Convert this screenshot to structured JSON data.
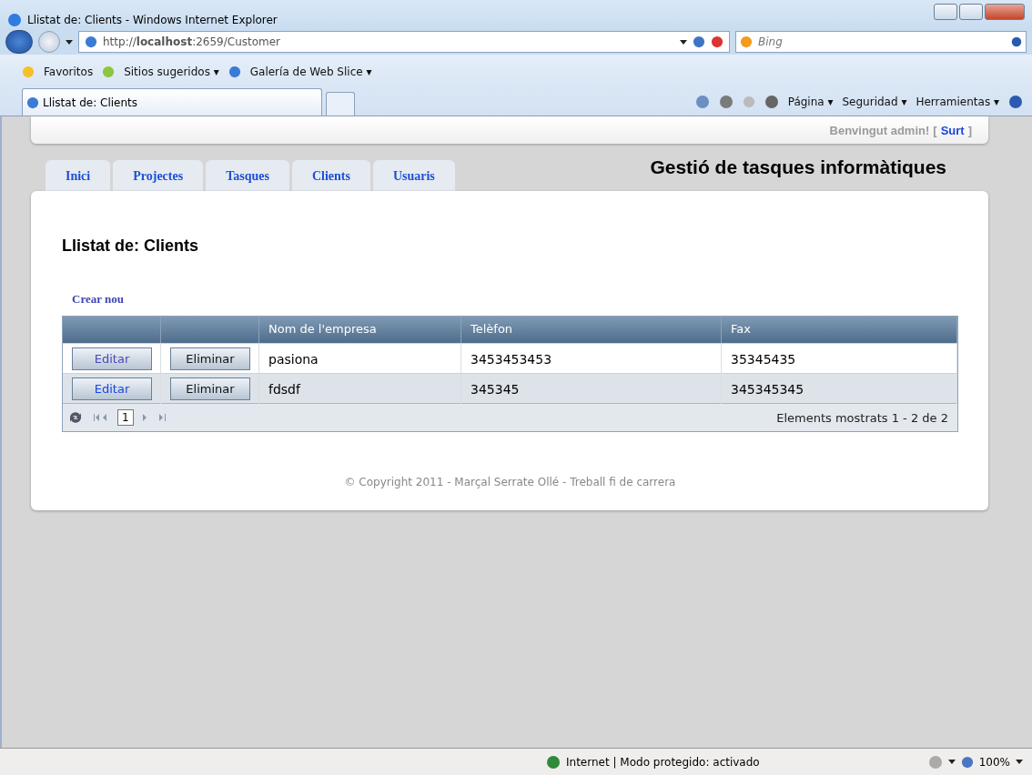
{
  "window": {
    "title": "Llistat de: Clients - Windows Internet Explorer"
  },
  "address_bar": {
    "url": "http://**localhost**:2659/Customer",
    "search_placeholder": "Bing"
  },
  "favorites_bar": {
    "items": [
      {
        "label": "Favoritos"
      },
      {
        "label": "Sitios sugeridos ▾"
      },
      {
        "label": "Galería de Web Slice ▾"
      }
    ]
  },
  "browser_tab": {
    "title": "Llistat de: Clients"
  },
  "command_bar": {
    "items": [
      "Página ▾",
      "Seguridad ▾",
      "Herramientas ▾"
    ]
  },
  "page": {
    "welcome": "Benvingut admin!",
    "open_bracket": "[",
    "logout": "Surt",
    "close_bracket": "]",
    "site_title": "Gestió de tasques informàtiques",
    "nav_tabs": [
      {
        "label": "Inici"
      },
      {
        "label": "Projectes"
      },
      {
        "label": "Tasques"
      },
      {
        "label": "Clients"
      },
      {
        "label": "Usuaris"
      }
    ],
    "heading": "Llistat de: Clients",
    "create_link": "Crear nou",
    "table": {
      "columns": [
        "",
        "",
        "Nom de l'empresa",
        "Telèfon",
        "Fax"
      ],
      "rows": [
        {
          "edit": "Editar",
          "delete": "Eliminar",
          "company": "pasiona",
          "phone": "3453453453",
          "fax": "35345435",
          "visited": true
        },
        {
          "edit": "Editar",
          "delete": "Eliminar",
          "company": "fdsdf",
          "phone": "345345",
          "fax": "345345345",
          "visited": false
        }
      ],
      "pager": {
        "page": "1",
        "summary": "Elements mostrats 1 - 2 de 2"
      }
    },
    "footer": "© Copyright 2011 - Marçal Serrate Ollé - Treball fi de carrera"
  },
  "status_bar": {
    "zone": "Internet | Modo protegido: activado",
    "zoom": "100%"
  }
}
